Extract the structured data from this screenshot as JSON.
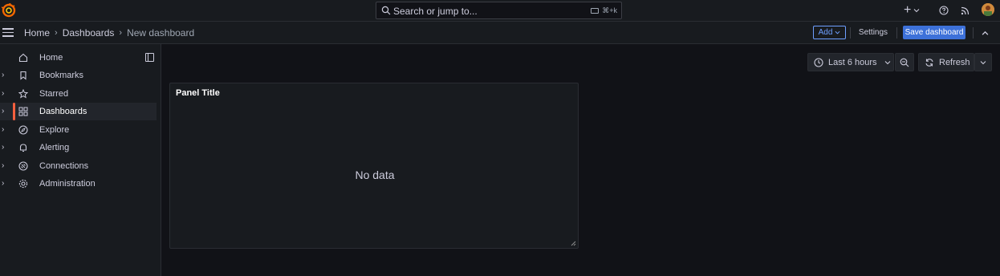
{
  "search": {
    "placeholder": "Search or jump to...",
    "shortcut": "⌘+k"
  },
  "breadcrumbs": [
    {
      "label": "Home"
    },
    {
      "label": "Dashboards"
    },
    {
      "label": "New dashboard"
    }
  ],
  "toolbar": {
    "add_label": "Add",
    "settings_label": "Settings",
    "save_label": "Save dashboard"
  },
  "sidebar": {
    "items": [
      {
        "label": "Home",
        "icon": "home-icon"
      },
      {
        "label": "Bookmarks",
        "icon": "bookmark-icon"
      },
      {
        "label": "Starred",
        "icon": "star-icon"
      },
      {
        "label": "Dashboards",
        "icon": "dashboards-grid-icon",
        "active": true
      },
      {
        "label": "Explore",
        "icon": "compass-icon"
      },
      {
        "label": "Alerting",
        "icon": "bell-icon"
      },
      {
        "label": "Connections",
        "icon": "connections-icon"
      },
      {
        "label": "Administration",
        "icon": "cog-icon"
      }
    ]
  },
  "time_picker": {
    "label": "Last 6 hours"
  },
  "refresh": {
    "label": "Refresh"
  },
  "panel": {
    "title": "Panel Title",
    "empty_text": "No data"
  },
  "colors": {
    "accent": "#3d71d9",
    "active_marker": "#f55f3e",
    "link": "#6e9fff",
    "background": "#111217",
    "surface": "#181b1f"
  }
}
